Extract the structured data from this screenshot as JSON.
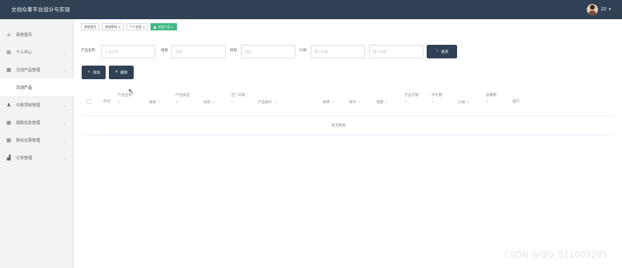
{
  "header": {
    "app_title": "文创众筹平台设计与实现",
    "username": "22",
    "caret": "▾"
  },
  "sidebar": {
    "items": [
      {
        "label": "系统首页",
        "icon": "home-icon",
        "glyph": "⌂",
        "arrow": ""
      },
      {
        "label": "个人中心",
        "icon": "calendar-icon",
        "glyph": "▤",
        "arrow": "⌄"
      },
      {
        "label": "文创产品管理",
        "icon": "grid-icon",
        "glyph": "▦",
        "arrow": "⌄"
      },
      {
        "label": "文创产品",
        "icon": "",
        "glyph": "",
        "arrow": ""
      },
      {
        "label": "众筹项目管理",
        "icon": "user-icon",
        "glyph": "♟",
        "arrow": "⌄"
      },
      {
        "label": "捐款信息管理",
        "icon": "grid-icon",
        "glyph": "▦",
        "arrow": "⌄"
      },
      {
        "label": "购买记录管理",
        "icon": "grid-icon",
        "glyph": "▦",
        "arrow": "⌄"
      },
      {
        "label": "订单管理",
        "icon": "chart-icon",
        "glyph": "▟",
        "arrow": "⌄"
      }
    ]
  },
  "tags": [
    {
      "label": "系统首页",
      "active": false
    },
    {
      "label": "修改密码 ×",
      "active": false
    },
    {
      "label": "个人信息 ×",
      "active": false
    },
    {
      "label": "文创产品 ×",
      "active": true
    }
  ],
  "search": {
    "product_name_label": "产品名称",
    "product_name_placeholder": "产品名称",
    "spec_label": "规格",
    "spec_placeholder": "规格",
    "material_label": "材质",
    "material_placeholder": "材质",
    "price_label": "价格",
    "price_min_placeholder": "最小价格",
    "price_max_placeholder": "最大价格",
    "query_button": "查询",
    "query_icon": "♡"
  },
  "toolbar": {
    "add_label": "添加",
    "add_icon": "+",
    "delete_label": "删除",
    "delete_icon": "✕"
  },
  "table": {
    "columns": [
      {
        "label": "序号",
        "sortable": false
      },
      {
        "label": "产品名称",
        "sortable": true
      },
      {
        "label": "规格",
        "sortable": true
      },
      {
        "label": "产品类型",
        "sortable": true
      },
      {
        "label": "材质",
        "sortable": true
      },
      {
        "label": "出厂日期",
        "sortable": true
      },
      {
        "label": "产品图片",
        "sortable": true
      },
      {
        "label": "邮费",
        "sortable": true
      },
      {
        "label": "库存",
        "sortable": true
      },
      {
        "label": "销量",
        "sortable": true
      },
      {
        "label": "点击次数",
        "sortable": true
      },
      {
        "label": "评论数",
        "sortable": true
      },
      {
        "label": "价格",
        "sortable": true
      },
      {
        "label": "收藏数",
        "sortable": true
      },
      {
        "label": "操作",
        "sortable": false
      }
    ],
    "sort_glyph": "⇕",
    "empty_text": "暂无数据"
  },
  "watermark": "CSDN @QQ_511008285"
}
